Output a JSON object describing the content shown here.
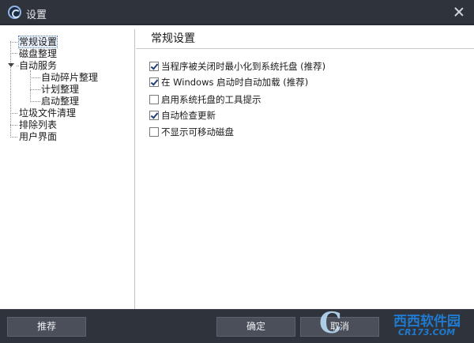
{
  "window": {
    "title": "设置",
    "icon": "app-logo-icon",
    "close_icon": "close-icon"
  },
  "tree": {
    "items": [
      {
        "label": "常规设置",
        "selected": true
      },
      {
        "label": "磁盘整理"
      },
      {
        "label": "自动服务",
        "expanded": true
      },
      {
        "label": "自动碎片整理"
      },
      {
        "label": "计划整理"
      },
      {
        "label": "启动整理"
      },
      {
        "label": "垃圾文件清理"
      },
      {
        "label": "排除列表"
      },
      {
        "label": "用户界面"
      }
    ]
  },
  "panel": {
    "title": "常规设置",
    "options": [
      {
        "label": "当程序被关闭时最小化到系统托盘 (推荐)",
        "checked": true
      },
      {
        "label": "在 Windows 启动时自动加载 (推荐)",
        "checked": true
      },
      {
        "label": "启用系统托盘的工具提示",
        "checked": false
      },
      {
        "label": "自动检查更新",
        "checked": true
      },
      {
        "label": "不显示可移动磁盘",
        "checked": false
      }
    ]
  },
  "buttons": {
    "recommend": "推荐",
    "ok": "确定",
    "cancel": "取消"
  },
  "watermark": {
    "brand": "西西软件园",
    "site": "CR173.COM"
  }
}
